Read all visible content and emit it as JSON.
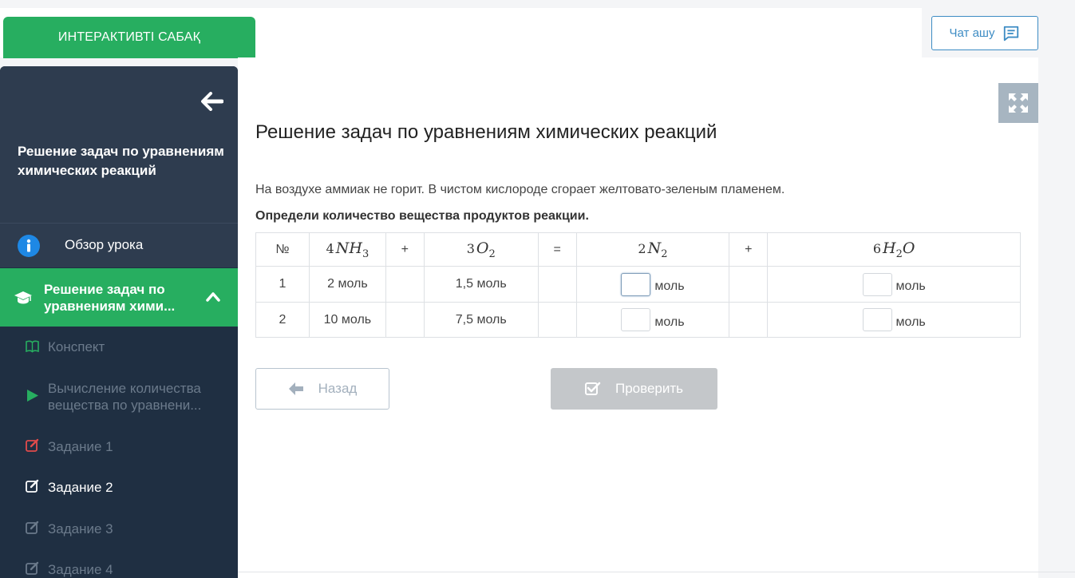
{
  "header": {
    "interactive_label": "ИНТЕРАКТИВТІ САБАҚ",
    "chat_label": "Чат ашу"
  },
  "sidebar": {
    "title": "Решение задач по уравнениям химических реакций",
    "overview_label": "Обзор урока",
    "section_label": "Решение задач по уравнениям хими...",
    "items": [
      {
        "label": "Конспект",
        "icon": "book-icon",
        "color": "#27ae60",
        "state": "muted"
      },
      {
        "label": "Вычисление количества вещества по уравнени...",
        "icon": "play-icon",
        "color": "#27ae60",
        "state": "muted"
      },
      {
        "label": "Задание 1",
        "icon": "edit-icon",
        "color": "#e14b4b",
        "state": "muted"
      },
      {
        "label": "Задание 2",
        "icon": "edit-icon",
        "color": "#ffffff",
        "state": "current"
      },
      {
        "label": "Задание 3",
        "icon": "edit-icon",
        "color": "#6b7a8b",
        "state": "muted"
      },
      {
        "label": "Задание 4",
        "icon": "edit-icon",
        "color": "#6b7a8b",
        "state": "muted"
      }
    ]
  },
  "main": {
    "title": "Решение задач по уравнениям химических реакций",
    "description": "На воздухе аммиак не горит. В чистом кислороде сгорает желтовато-зеленым пламенем.",
    "instruction": "Определи количество вещества продуктов реакции.",
    "table": {
      "header": {
        "num": "№",
        "nh3_coef": "4",
        "nh3_main": "NH",
        "nh3_sub": "3",
        "plus1": "+",
        "o2_coef": "3",
        "o2_main": "O",
        "o2_sub": "2",
        "eq": "=",
        "n2_coef": "2",
        "n2_main": "N",
        "n2_sub": "2",
        "plus2": "+",
        "h2o_coef": "6",
        "h2o_main1": "H",
        "h2o_sub": "2",
        "h2o_main2": "O"
      },
      "rows": [
        {
          "num": "1",
          "nh3": "2 моль",
          "o2": "1,5 моль",
          "unit": "моль"
        },
        {
          "num": "2",
          "nh3": "10 моль",
          "o2": "7,5 моль",
          "unit": "моль"
        }
      ]
    },
    "back_label": "Назад",
    "check_label": "Проверить"
  },
  "colors": {
    "accent_green": "#27ae60",
    "sidebar_dark": "#1f2f42",
    "sidebar_head": "#2e3c4f",
    "chat_blue": "#3d8cc4",
    "disabled_gray": "#c4c7ca"
  }
}
